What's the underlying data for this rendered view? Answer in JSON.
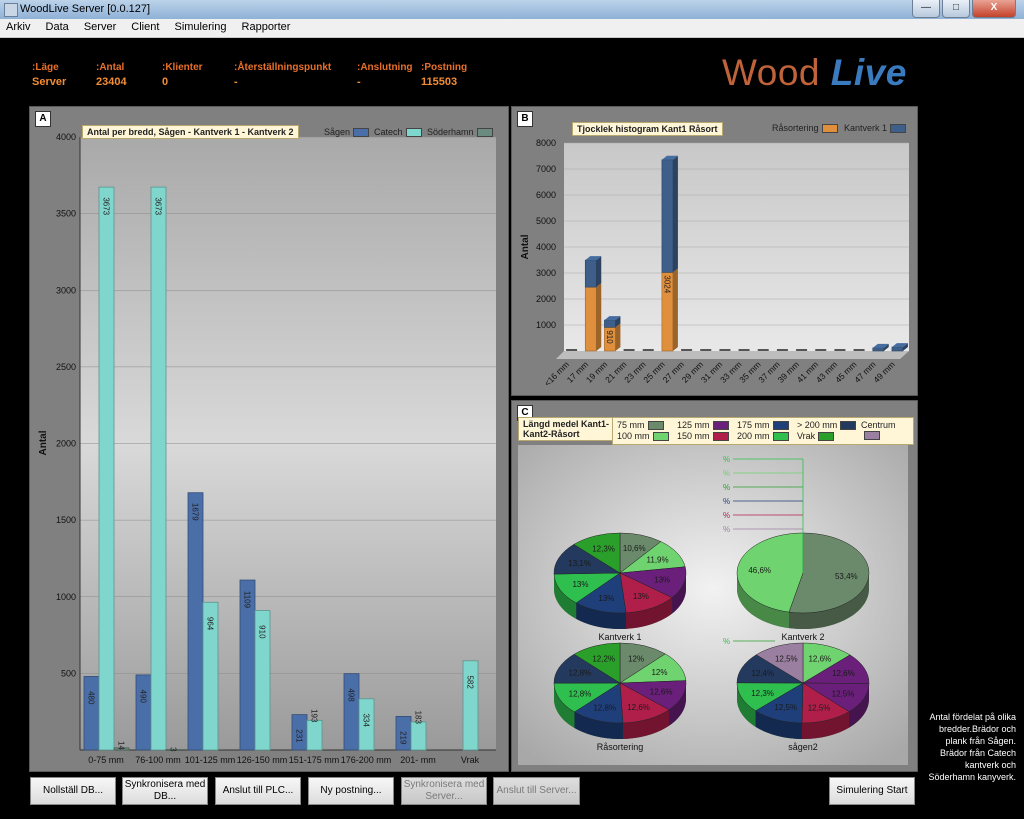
{
  "window": {
    "title": "WoodLive Server  [0.0.127]",
    "min_label": "—",
    "max_label": "□",
    "close_label": "X"
  },
  "menu": [
    "Arkiv",
    "Data",
    "Server",
    "Client",
    "Simulering",
    "Rapporter"
  ],
  "status": [
    {
      "label": ":Läge",
      "value": "Server"
    },
    {
      "label": ":Antal",
      "value": "23404"
    },
    {
      "label": ":Klienter",
      "value": "0"
    },
    {
      "label": ":Återställningspunkt",
      "value": "-"
    },
    {
      "label": ":Anslutning",
      "value": "-"
    },
    {
      "label": ":Postning",
      "value": "115503"
    }
  ],
  "logo": {
    "word1": "Wood",
    "word2": "Live"
  },
  "panels": {
    "a": "A",
    "b": "B",
    "c": "C"
  },
  "chart_data": [
    {
      "type": "bar",
      "title": "Antal per bredd, Sågen - Kantverk 1 - Kantverk 2",
      "ylabel": "Antal",
      "ylim": [
        0,
        4000
      ],
      "yticks": [
        500,
        1000,
        1500,
        2000,
        2500,
        3000,
        3500,
        4000
      ],
      "categories": [
        "0-75 mm",
        "76-100 mm",
        "101-125 mm",
        "126-150 mm",
        "151-175 mm",
        "176-200 mm",
        "201- mm",
        "Vrak"
      ],
      "series": [
        {
          "name": "Sågen",
          "color": "#4a6ea8",
          "values": [
            480,
            490,
            1679,
            1109,
            231,
            498,
            219,
            null
          ]
        },
        {
          "name": "Catech",
          "color": "#7fd6cc",
          "values": [
            3673,
            3673,
            964,
            910,
            193,
            334,
            183,
            582
          ]
        },
        {
          "name": "Söderhamn",
          "color": "#6b8a80",
          "values": [
            14,
            3,
            null,
            null,
            null,
            null,
            null,
            null
          ]
        }
      ]
    },
    {
      "type": "bar",
      "title": "Tjocklek histogram Kant1 Råsort",
      "ylabel": "Antal",
      "ylim": [
        0,
        8000
      ],
      "yticks": [
        1000,
        2000,
        3000,
        4000,
        5000,
        6000,
        7000,
        8000
      ],
      "categories": [
        "<16 mm",
        "17 mm",
        "19 mm",
        "21 mm",
        "23 mm",
        "25 mm",
        "27 mm",
        "29 mm",
        "31 mm",
        "33 mm",
        "35 mm",
        "37 mm",
        "39 mm",
        "41 mm",
        "43 mm",
        "45 mm",
        "47 mm",
        "49 mm"
      ],
      "series": [
        {
          "name": "Råsortering",
          "color": "#e08f3c",
          "values": [
            0,
            2458,
            910,
            0,
            0,
            3024,
            0,
            0,
            0,
            0,
            0,
            0,
            0,
            0,
            0,
            0,
            0,
            0
          ],
          "labels": [
            "",
            "",
            "910",
            "",
            "",
            "3024",
            "",
            "",
            "",
            "",
            "",
            "",
            "",
            "",
            "",
            "",
            "",
            ""
          ]
        },
        {
          "name": "Kantverk 1",
          "color": "#3d5f8a",
          "values": [
            0,
            1037,
            279,
            0,
            0,
            4330,
            0,
            0,
            0,
            0,
            0,
            0,
            0,
            0,
            0,
            0,
            120,
            150
          ],
          "labels": [
            "",
            "",
            "",
            "",
            "",
            "",
            "",
            "",
            "",
            "",
            "",
            "",
            "",
            "",
            "",
            "",
            "",
            ""
          ]
        }
      ]
    },
    {
      "type": "pie",
      "title": "Längd medel Kant1-Kant2-Råsort",
      "legend": [
        {
          "name": "75 mm",
          "color": "#6b8a6b"
        },
        {
          "name": "125 mm",
          "color": "#6a1f7a"
        },
        {
          "name": "175 mm",
          "color": "#1f3f7a"
        },
        {
          "name": "> 200 mm",
          "color": "#233a5e"
        },
        {
          "name": "Centrum",
          "color": "#9b7fa0"
        },
        {
          "name": "100 mm",
          "color": "#6fd36f"
        },
        {
          "name": "150 mm",
          "color": "#b01f4a"
        },
        {
          "name": "200 mm",
          "color": "#2fbf4f"
        },
        {
          "name": "Vrak",
          "color": "#2aa02a"
        }
      ],
      "pies": [
        {
          "name": "Kantverk 1",
          "slices": [
            {
              "label": "10,6%",
              "value": 10.6,
              "color": "#6b8a6b"
            },
            {
              "label": "11,9%",
              "value": 11.9,
              "color": "#6fd36f"
            },
            {
              "label": "13%",
              "value": 13,
              "color": "#6a1f7a"
            },
            {
              "label": "13%",
              "value": 13,
              "color": "#b01f4a"
            },
            {
              "label": "13%",
              "value": 13,
              "color": "#1f3f7a"
            },
            {
              "label": "13%",
              "value": 13,
              "color": "#2fbf4f"
            },
            {
              "label": "13,1%",
              "value": 13.1,
              "color": "#233a5e"
            },
            {
              "label": "12,3%",
              "value": 12.3,
              "color": "#2aa02a"
            }
          ]
        },
        {
          "name": "Kantverk 2",
          "slices": [
            {
              "label": "53,4%",
              "value": 53.4,
              "color": "#6b8a6b"
            },
            {
              "label": "46,6%",
              "value": 46.6,
              "color": "#6fd36f"
            }
          ],
          "callouts": [
            "%",
            "%",
            "%",
            "%",
            "%",
            "%"
          ]
        },
        {
          "name": "Råsortering",
          "slices": [
            {
              "label": "12%",
              "value": 12,
              "color": "#6b8a6b"
            },
            {
              "label": "12%",
              "value": 12,
              "color": "#6fd36f"
            },
            {
              "label": "12,6%",
              "value": 12.6,
              "color": "#6a1f7a"
            },
            {
              "label": "12,6%",
              "value": 12.6,
              "color": "#b01f4a"
            },
            {
              "label": "12,8%",
              "value": 12.8,
              "color": "#1f3f7a"
            },
            {
              "label": "12,8%",
              "value": 12.8,
              "color": "#2fbf4f"
            },
            {
              "label": "12,8%",
              "value": 12.8,
              "color": "#233a5e"
            },
            {
              "label": "12,2%",
              "value": 12.2,
              "color": "#2aa02a"
            }
          ]
        },
        {
          "name": "sågen2",
          "slices": [
            {
              "label": "12,6%",
              "value": 12.6,
              "color": "#6fd36f"
            },
            {
              "label": "12,6%",
              "value": 12.6,
              "color": "#6a1f7a"
            },
            {
              "label": "12,5%",
              "value": 12.5,
              "color": "#6a1f7a"
            },
            {
              "label": "12,5%",
              "value": 12.5,
              "color": "#b01f4a"
            },
            {
              "label": "12,5%",
              "value": 12.5,
              "color": "#1f3f7a"
            },
            {
              "label": "12,3%",
              "value": 12.3,
              "color": "#2fbf4f"
            },
            {
              "label": "12,4%",
              "value": 12.4,
              "color": "#233a5e"
            },
            {
              "label": "12,5%",
              "value": 12.5,
              "color": "#9b7fa0"
            }
          ],
          "callouts": [
            "%"
          ]
        }
      ]
    }
  ],
  "buttons": [
    {
      "label": "Nollställ DB...",
      "disabled": false
    },
    {
      "label": "Synkronisera med DB...",
      "disabled": false
    },
    {
      "label": "Anslut till PLC...",
      "disabled": false
    },
    {
      "label": "Ny postning...",
      "disabled": false
    },
    {
      "label": "Synkronisera med Server...",
      "disabled": true
    },
    {
      "label": "Anslut till Server...",
      "disabled": true
    },
    {
      "label": "Simulering Start",
      "disabled": false
    }
  ],
  "side_note": "Antal fördelat på olika bredder.Brädor och plank från Sågen. Brädor från Catech kantverk och Söderhamn kanyverk."
}
